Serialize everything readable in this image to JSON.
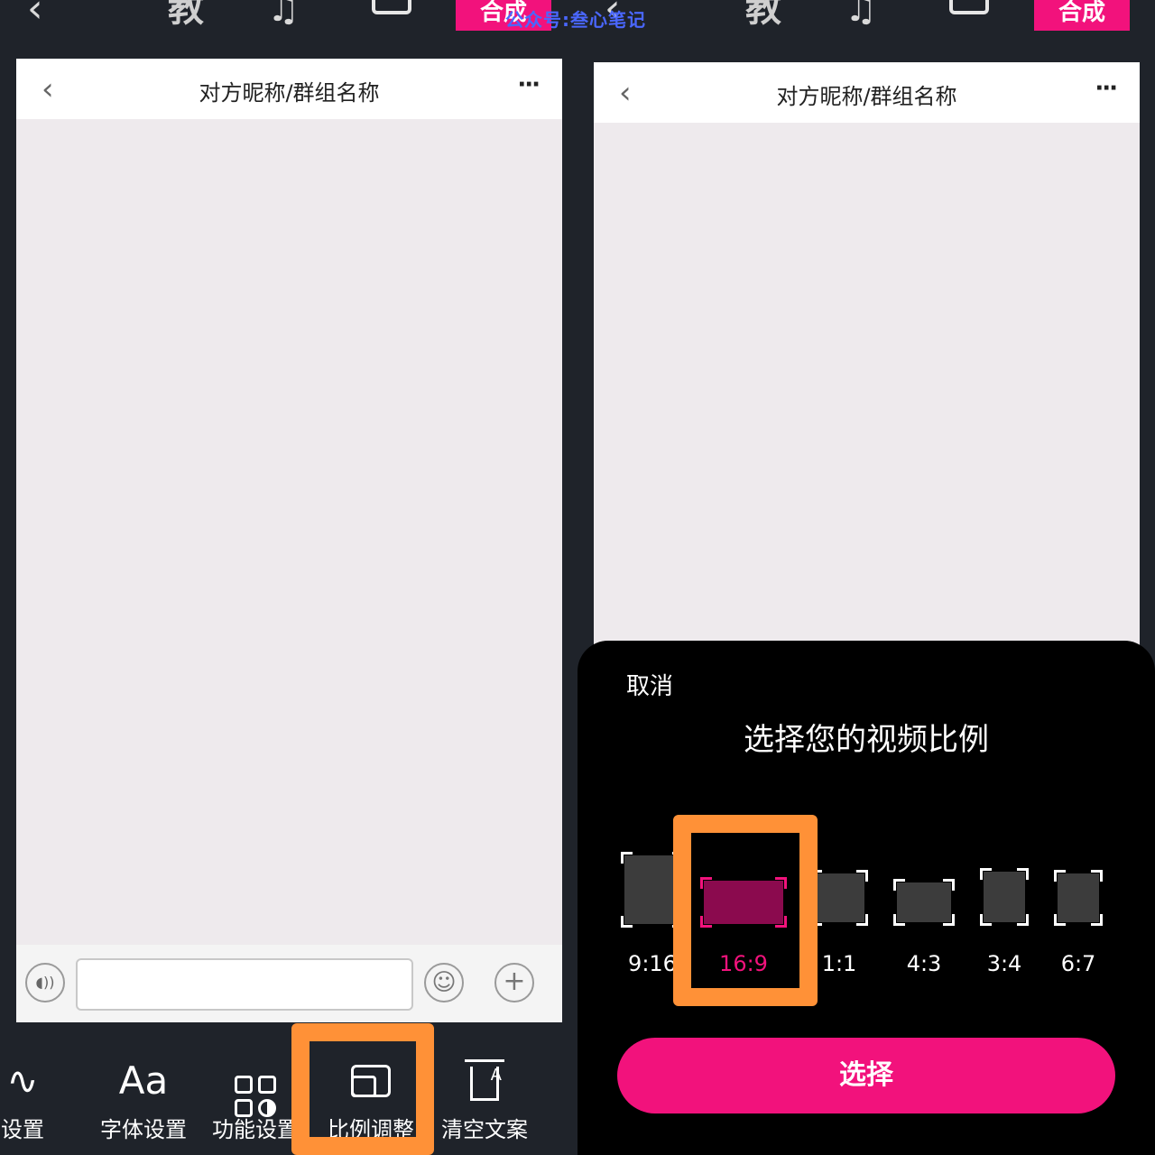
{
  "topbar": {
    "back_icon": "←",
    "jiao_label": "教",
    "music_icon": "music-icon",
    "save_icon": "save-icon",
    "compose_label": "合成"
  },
  "watermark": "公众号:叁心笔记",
  "chat": {
    "title": "对方昵称/群组名称",
    "more": "···"
  },
  "toolbar": {
    "items": [
      {
        "label": "设置"
      },
      {
        "label": "字体设置",
        "icon_text": "Aa"
      },
      {
        "label": "功能设置"
      },
      {
        "label": "比例调整"
      },
      {
        "label": "清空文案"
      }
    ]
  },
  "ratio_sheet": {
    "cancel_label": "取消",
    "title": "选择您的视频比例",
    "options": [
      "9:16",
      "16:9",
      "1:1",
      "4:3",
      "3:4",
      "6:7"
    ],
    "selected": "16:9",
    "select_label": "选择"
  },
  "colors": {
    "accent": "#f2127c",
    "highlight": "#ff9137",
    "background": "#1f232a",
    "chat_bg": "#eeeaed"
  }
}
